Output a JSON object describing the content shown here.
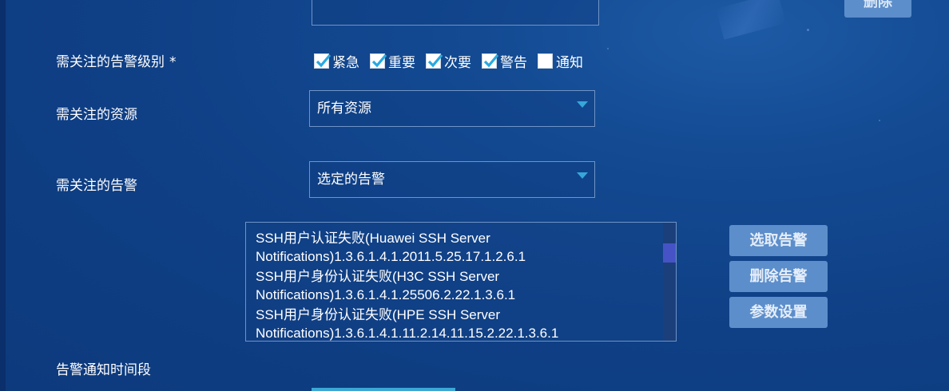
{
  "top": {
    "delete_label": "删除"
  },
  "alarm_level": {
    "label": "需关注的告警级别",
    "required_mark": "*",
    "options": [
      {
        "label": "紧急",
        "checked": true
      },
      {
        "label": "重要",
        "checked": true
      },
      {
        "label": "次要",
        "checked": true
      },
      {
        "label": "警告",
        "checked": true
      },
      {
        "label": "通知",
        "checked": false
      }
    ]
  },
  "resources": {
    "label": "需关注的资源",
    "value": "所有资源"
  },
  "alarms": {
    "label": "需关注的告警",
    "value": "选定的告警",
    "list": [
      {
        "line1": "SSH用户认证失败(Huawei SSH Server",
        "line2": "Notifications)1.3.6.1.4.1.2011.5.25.17.1.2.6.1"
      },
      {
        "line1": "SSH用户身份认证失败(H3C SSH Server",
        "line2": "Notifications)1.3.6.1.4.1.25506.2.22.1.3.6.1"
      },
      {
        "line1": "SSH用户身份认证失败(HPE SSH Server",
        "line2": "Notifications)1.3.6.1.4.1.11.2.14.11.15.2.22.1.3.6.1"
      }
    ],
    "buttons": {
      "select": "选取告警",
      "delete": "删除告警",
      "params": "参数设置"
    }
  },
  "notify_period": {
    "label": "告警通知时间段"
  },
  "colors": {
    "background": "#0f3f85",
    "button": "#5c8ecb",
    "caret": "#37a7d9",
    "check": "#29a9e1"
  }
}
